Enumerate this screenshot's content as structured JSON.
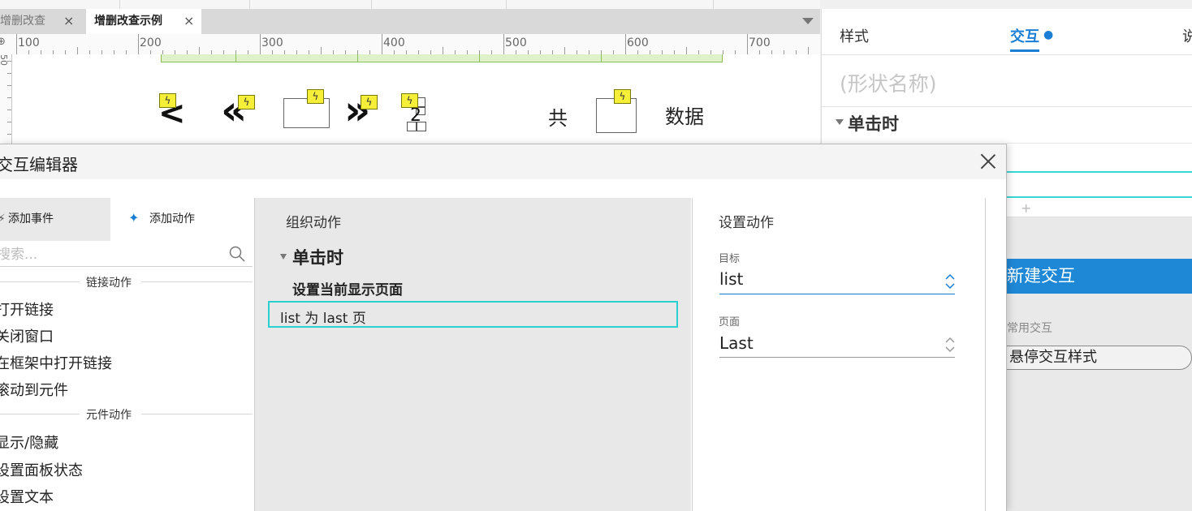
{
  "tabs": [
    {
      "label": "增删改查",
      "close": "×"
    },
    {
      "label": "增删改查示例",
      "close": "×"
    }
  ],
  "ruler": {
    "labels": [
      "100",
      "200",
      "300",
      "400",
      "500",
      "600",
      "700"
    ],
    "vertical_label": "50"
  },
  "canvas": {
    "pager": {
      "prev": "<",
      "first": "«",
      "next": "»",
      "last_page_number": "2",
      "total_prefix": "共",
      "data_label": "数据"
    }
  },
  "right_panel": {
    "tabs": {
      "style": "样式",
      "interaction": "交互",
      "notes": "说"
    },
    "shape_name_placeholder": "(形状名称)",
    "event": "单击时",
    "add": "+",
    "new_interaction": "新建交互",
    "common_interactions_label": "常用交互",
    "hover_style_button": "悬停交互样式"
  },
  "dialog": {
    "title": "交互编辑器",
    "close": "×",
    "left": {
      "tab_add_event": "添加事件",
      "tab_add_action": "添加动作",
      "search_placeholder": "搜索...",
      "sections": [
        {
          "title": "链接动作",
          "items": [
            "打开链接",
            "关闭窗口",
            "在框架中打开链接",
            "滚动到元件"
          ]
        },
        {
          "title": "元件动作",
          "items": [
            "显示/隐藏",
            "设置面板状态",
            "设置文本"
          ]
        }
      ]
    },
    "middle": {
      "title": "组织动作",
      "event": "单击时",
      "action": "设置当前显示页面",
      "selected_row": "list 为 last 页"
    },
    "right": {
      "title": "设置动作",
      "target_label": "目标",
      "target_value": "list",
      "page_label": "页面",
      "page_value": "Last"
    }
  },
  "colors": {
    "accent": "#1a7fd4",
    "selection": "#2ccfcf",
    "lightning": "#f5ef3a"
  },
  "icons": {
    "search": "search-icon",
    "close": "close-icon",
    "lightning": "lightning-icon",
    "sparkle": "sparkle-icon",
    "updown": "updown-arrows-icon"
  }
}
